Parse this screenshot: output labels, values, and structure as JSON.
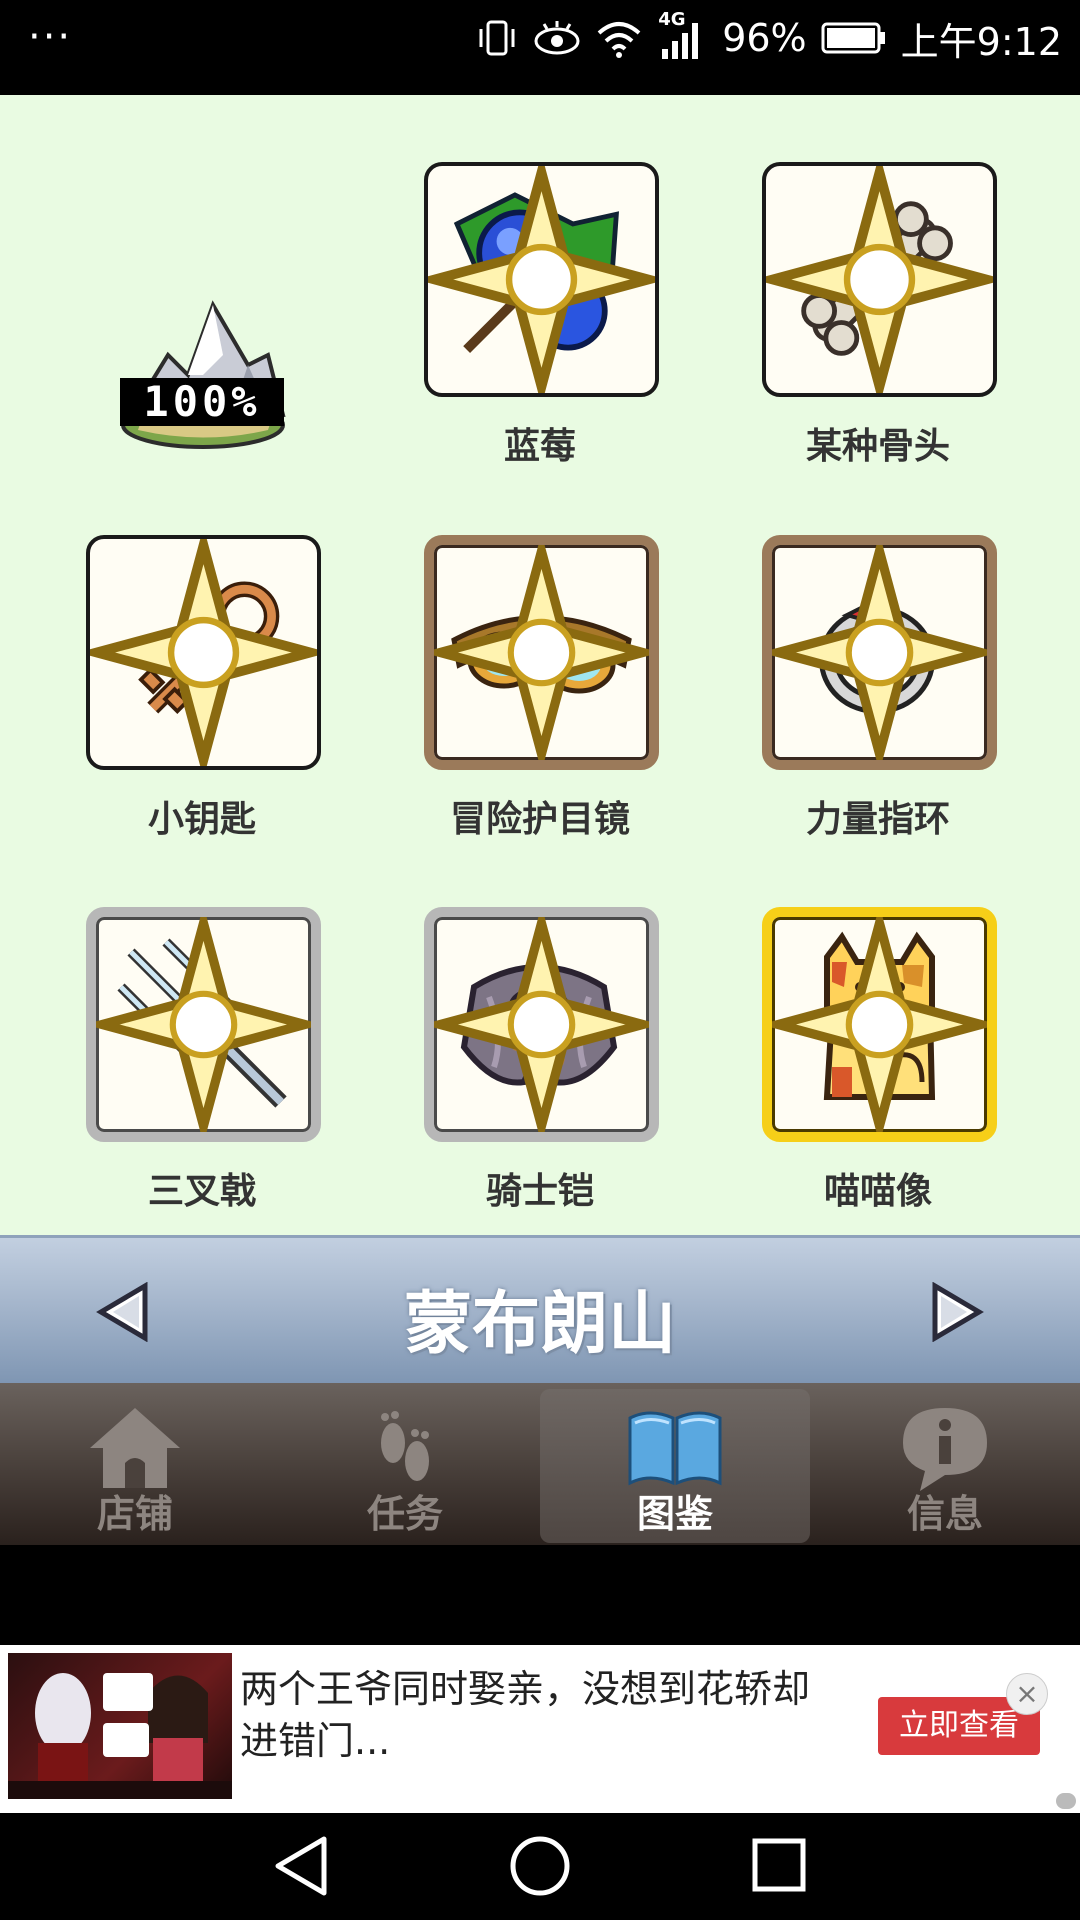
{
  "status_bar": {
    "menu": "···",
    "battery_percent": "96%",
    "network": "4G",
    "time": "上午9:12"
  },
  "region": {
    "completion": "100%",
    "name": "蒙布朗山"
  },
  "items": [
    {
      "label": "蓝莓",
      "frame": "plain"
    },
    {
      "label": "某种骨头",
      "frame": "plain"
    },
    {
      "label": "小钥匙",
      "frame": "plain"
    },
    {
      "label": "冒险护目镜",
      "frame": "brown"
    },
    {
      "label": "力量指环",
      "frame": "brown"
    },
    {
      "label": "三叉戟",
      "frame": "silver"
    },
    {
      "label": "骑士铠",
      "frame": "silver"
    },
    {
      "label": "喵喵像",
      "frame": "gold"
    }
  ],
  "tabs": [
    {
      "label": "店铺",
      "icon": "house-icon",
      "active": false
    },
    {
      "label": "任务",
      "icon": "footprints-icon",
      "active": false
    },
    {
      "label": "图鉴",
      "icon": "book-icon",
      "active": true
    },
    {
      "label": "信息",
      "icon": "info-bubble-icon",
      "active": false
    }
  ],
  "ad": {
    "text": "两个王爷同时娶亲，没想到花轿却进错门...",
    "button": "立即查看",
    "close": "×"
  },
  "colors": {
    "game_bg": "#e9fbe2",
    "gold_frame": "#f6cf18",
    "brown_frame": "#9b7a5a",
    "silver_frame": "#b7b7b7",
    "ad_button": "#d83a3d"
  }
}
